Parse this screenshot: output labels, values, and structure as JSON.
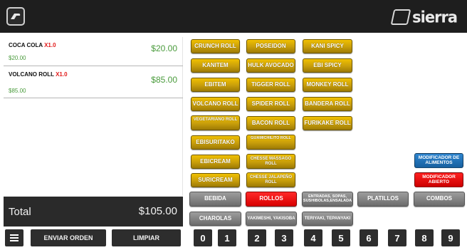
{
  "header": {
    "brand_name": "sierra"
  },
  "order": {
    "items": [
      {
        "name": "COCA COLA",
        "qty": "X1.0",
        "unit_price": "$20.00",
        "line_total": "$20.00"
      },
      {
        "name": "VOLCANO ROLL",
        "qty": "X1.0",
        "unit_price": "$85.00",
        "line_total": "$85.00"
      }
    ],
    "total_label": "Total",
    "total_value": "$105.00"
  },
  "actions": {
    "menu_icon": "menu-icon",
    "send_label": "ENVIAR ORDEN",
    "clear_label": "LIMPIAR"
  },
  "products": [
    "CRUNCH ROLL",
    "POSEIDON",
    "KANI SPICY",
    "KANITEM",
    "HULK AVOCADO",
    "EBI SPICY",
    "EBITEM",
    "TIGGER ROLL",
    "MONKEY ROLL",
    "VOLCANO ROLL",
    "SPIDER ROLL",
    "BANDERA ROLL",
    "VEGETARIANO ROLL",
    "BACON ROLL",
    "FURIKAKE ROLL",
    "EBISURITAKO",
    "GUAMICHILITO ROLL",
    "EBICREAM",
    "CHESSE MASSAGO ROLL",
    "SURICREAM",
    "CHESSE JALAPEÑO ROLL"
  ],
  "modifiers": [
    {
      "label": "MODIFICADOR DE ALIMENTOS",
      "color": "#1d6fb8"
    },
    {
      "label": "MODIFICADOR ABIERTO",
      "color": "#e20f0f"
    }
  ],
  "categories": [
    {
      "label": "BEBIDA",
      "active": false
    },
    {
      "label": "ROLLOS",
      "active": true
    },
    {
      "label": "ENTRADAS, SOPAS, SUSHIBOLAS,ENSALADA",
      "active": false
    },
    {
      "label": "PLATILLOS",
      "active": false
    },
    {
      "label": "COMBOS",
      "active": false
    },
    {
      "label": "CHAROLAS",
      "active": false
    },
    {
      "label": "YAKIMESHI, YAKISOBA",
      "active": false
    },
    {
      "label": "TERIYAKI, TEPANYAKI",
      "active": false
    }
  ],
  "digits": [
    "0",
    "1",
    "2",
    "3",
    "4",
    "5",
    "6",
    "7",
    "8",
    "9"
  ],
  "colors": {
    "gold": "#d4a80a",
    "active_category": "#ff1a1a",
    "price_green": "#4a9b3c",
    "qty_red": "#e11b1b"
  }
}
